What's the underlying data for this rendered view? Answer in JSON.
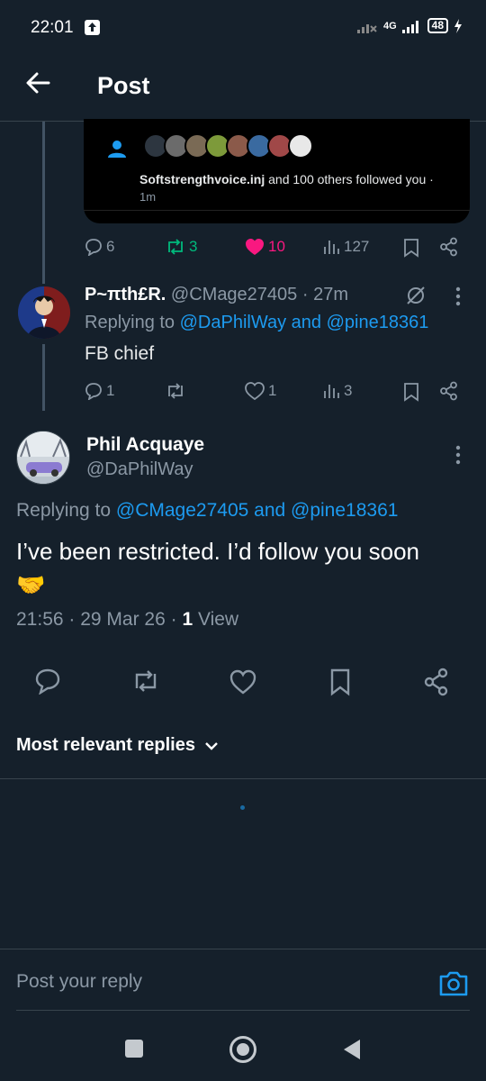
{
  "status_bar": {
    "time": "22:01",
    "network": "4G",
    "battery": "48",
    "icons": [
      "upload-notification-icon",
      "no-signal-icon",
      "signal-icon",
      "battery-icon",
      "charging-icon"
    ]
  },
  "header": {
    "title": "Post",
    "back_icon": "arrow-left-icon"
  },
  "embedded_card": {
    "follower_name": "Softstrengthvoice.inj",
    "follow_text": " and 100 others followed you ·",
    "time_ago": "1m",
    "avatar_colors": [
      "#2d3640",
      "#6b6b6b",
      "#7a6a55",
      "#7d9a3a",
      "#8b5a4a",
      "#3a6aa0",
      "#a04848",
      "#e8e8e8"
    ]
  },
  "embedded_actions": {
    "replies": "6",
    "reposts": "3",
    "likes": "10",
    "views": "127"
  },
  "reply1": {
    "name": "P~πth£R.",
    "handle": "@CMage27405",
    "separator": " · ",
    "time": "27m",
    "replying_prefix": "Replying to ",
    "replying_to": "@DaPhilWay and @pine18361",
    "text": "FB chief",
    "replies": "1",
    "likes": "1",
    "views": "3"
  },
  "main_post": {
    "name": "Phil Acquaye",
    "handle": "@DaPhilWay",
    "replying_prefix": "Replying to ",
    "replying_to": "@CMage27405 and @pine18361",
    "text": "I’ve been restricted. I’d follow you soon",
    "emoji": "🤝",
    "time": "21:56 · 29 Mar 26 · ",
    "view_count": "1",
    "view_label": " View"
  },
  "replies_filter": {
    "label": "Most relevant replies"
  },
  "composer": {
    "placeholder": "Post your reply"
  },
  "colors": {
    "background": "#15202b",
    "accent": "#1d9bf0",
    "repost": "#00ba7c",
    "like": "#f91880",
    "muted": "#8b98a5"
  }
}
